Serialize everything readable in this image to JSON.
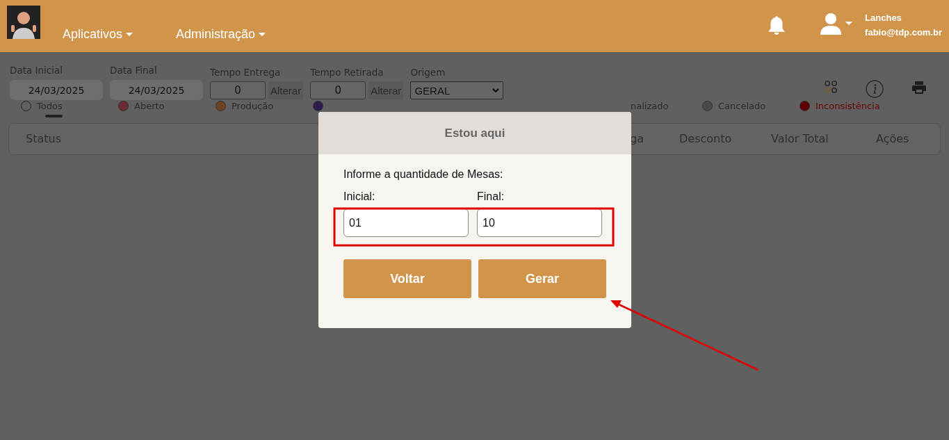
{
  "header": {
    "menus": [
      {
        "label": "Aplicativos"
      },
      {
        "label": "Administração"
      }
    ],
    "user": {
      "name": "Lanches",
      "email": "fabio@tdp.com.br"
    }
  },
  "filters": [
    {
      "label": "Data Inicial",
      "kind": "date",
      "value": "24/03/2025"
    },
    {
      "label": "Data Final",
      "kind": "date",
      "value": "24/03/2025"
    },
    {
      "label": "Tempo Entrega",
      "kind": "time",
      "value": "0",
      "button": "Alterar"
    },
    {
      "label": "Tempo Retirada",
      "kind": "time",
      "value": "0",
      "button": "Alterar"
    },
    {
      "label": "Origem",
      "kind": "select",
      "value": "GERAL"
    }
  ],
  "statuses": [
    {
      "label": "Todos",
      "color": "#606060",
      "selected": true
    },
    {
      "label": "Aberto",
      "color": "#6b2a34",
      "selected": false
    },
    {
      "label": "Produção",
      "color": "#6f4222",
      "selected": false
    },
    {
      "color": "#2d1a4e",
      "selected": false
    },
    {
      "label": "nalizado",
      "selected": false
    },
    {
      "label": "Cancelado",
      "color": "#4a4a4a",
      "selected": false
    },
    {
      "label": "Inconsistência",
      "color": "#5c0000",
      "selected": false
    }
  ],
  "table": {
    "columns": [
      "Status",
      "ga",
      "Desconto",
      "Valor Total",
      "Ações"
    ]
  },
  "modal": {
    "title": "Estou aqui",
    "prompt": "Informe a quantidade de Mesas:",
    "fields": [
      {
        "label": "Inicial:",
        "value": "01"
      },
      {
        "label": "Final:",
        "value": "10"
      }
    ],
    "buttons": [
      "Voltar",
      "Gerar"
    ]
  }
}
